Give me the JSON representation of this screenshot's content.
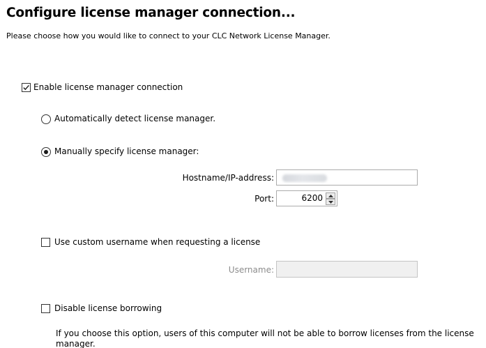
{
  "header": {
    "title": "Configure license manager connection...",
    "subtitle": "Please choose how you would like to connect to your CLC Network License Manager."
  },
  "enable_connection": {
    "label": "Enable license manager connection",
    "checked": true
  },
  "connection_mode": {
    "auto_label": "Automatically detect license manager.",
    "manual_label": "Manually specify license manager:",
    "selected": "manual"
  },
  "manual": {
    "hostname_label": "Hostname/IP-address:",
    "hostname_value": "",
    "port_label": "Port:",
    "port_value": "6200"
  },
  "custom_username": {
    "label": "Use custom username when requesting a license",
    "checked": false,
    "username_label": "Username:",
    "username_value": ""
  },
  "borrowing": {
    "label": "Disable license borrowing",
    "checked": false,
    "description": "If you choose this option, users of this computer will not be able to borrow licenses from the license manager."
  },
  "icons": {
    "checkmark": "checkmark-icon",
    "spin_up": "arrow-up-icon",
    "spin_down": "arrow-down-icon"
  },
  "colors": {
    "text": "#000000",
    "disabled_text": "#8c8c8c",
    "field_border": "#ababab",
    "disabled_field": "#f0f0f0"
  }
}
